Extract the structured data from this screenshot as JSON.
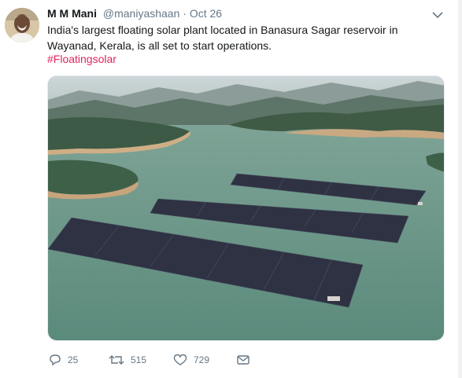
{
  "tweet": {
    "author_name": "M M Mani",
    "handle": "@maniyashaan",
    "separator": "·",
    "date": "Oct 26",
    "text_line1": "India's largest floating solar plant located in Banasura Sagar reservoir in",
    "text_line2": "Wayanad, Kerala, is all set to start operations.",
    "hashtag": "#Floatingsolar",
    "hashtag_color": "#e0245e"
  },
  "actions": {
    "reply": {
      "icon": "reply-icon",
      "count": "25"
    },
    "retweet": {
      "icon": "retweet-icon",
      "count": "515"
    },
    "like": {
      "icon": "heart-icon",
      "count": "729"
    },
    "dm": {
      "icon": "envelope-icon"
    }
  },
  "colors": {
    "text": "#14171a",
    "muted": "#657786",
    "water": "#5f8e80",
    "panel": "#2e3242"
  }
}
